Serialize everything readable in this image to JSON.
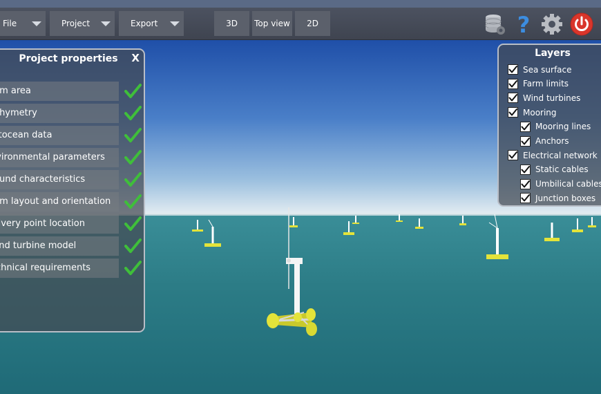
{
  "toolbar": {
    "file_label": "File",
    "project_label": "Project",
    "export_label": "Export",
    "view_3d_label": "3D",
    "top_view_label": "Top view",
    "view_2d_label": "2D"
  },
  "project_panel": {
    "title": "Project properties",
    "close_label": "X",
    "items": [
      {
        "label": "arm area",
        "done": true
      },
      {
        "label": "athymetry",
        "done": true
      },
      {
        "label": "letocean data",
        "done": true
      },
      {
        "label": "nvironmental parameters",
        "done": true
      },
      {
        "label": "round characteristics",
        "done": true
      },
      {
        "label": "arm layout and orientation",
        "done": true
      },
      {
        "label": "elivery point location",
        "done": true
      },
      {
        "label": "Vind turbine model",
        "done": true
      },
      {
        "label": "echnical requirements",
        "done": true
      }
    ]
  },
  "layers_panel": {
    "title": "Layers",
    "items": [
      {
        "label": "Sea surface",
        "checked": true,
        "indent": 0
      },
      {
        "label": "Farm limits",
        "checked": true,
        "indent": 0
      },
      {
        "label": "Wind turbines",
        "checked": true,
        "indent": 0
      },
      {
        "label": "Mooring",
        "checked": true,
        "indent": 0
      },
      {
        "label": "Mooring lines",
        "checked": true,
        "indent": 1
      },
      {
        "label": "Anchors",
        "checked": true,
        "indent": 1
      },
      {
        "label": "Electrical network",
        "checked": true,
        "indent": 0
      },
      {
        "label": "Static cables",
        "checked": true,
        "indent": 1
      },
      {
        "label": "Umbilical cables",
        "checked": true,
        "indent": 1
      },
      {
        "label": "Junction boxes",
        "checked": true,
        "indent": 1
      }
    ]
  },
  "icons": {
    "database": "database-settings-icon",
    "help": "help-icon",
    "settings": "gear-icon",
    "power": "power-icon"
  },
  "colors": {
    "power_red": "#d9362b",
    "help_blue": "#3c8de0",
    "check_green": "#3fbf3a",
    "platform_yellow": "#e3e33a",
    "sea": "#2f7f88"
  }
}
